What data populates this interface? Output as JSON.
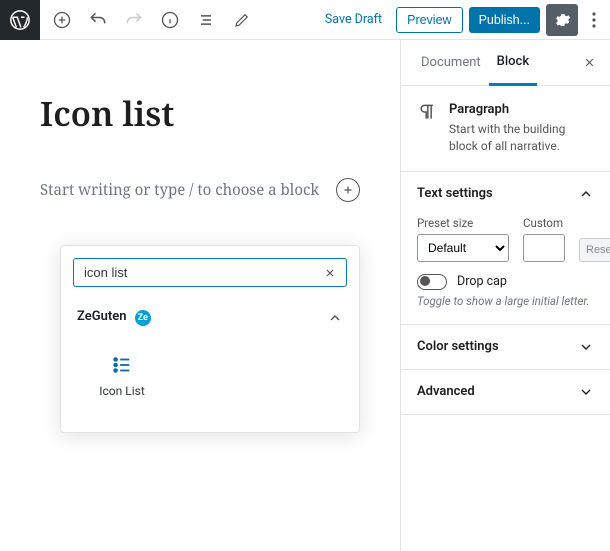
{
  "topbar": {
    "save_draft": "Save Draft",
    "preview": "Preview",
    "publish": "Publish..."
  },
  "editor": {
    "title": "Icon list",
    "placeholder": "Start writing or type / to choose a block"
  },
  "inserter": {
    "search_value": "icon list",
    "category": "ZeGuten",
    "badge": "Ze",
    "blocks": [
      {
        "label": "Icon List"
      }
    ]
  },
  "sidebar": {
    "tabs": {
      "document": "Document",
      "block": "Block"
    },
    "paragraph": {
      "title": "Paragraph",
      "desc": "Start with the building block of all narrative."
    },
    "text_settings": {
      "title": "Text settings",
      "preset_label": "Preset size",
      "preset_value": "Default",
      "custom_label": "Custom",
      "reset": "Reset",
      "dropcap_label": "Drop cap",
      "dropcap_help": "Toggle to show a large initial letter."
    },
    "color_settings": "Color settings",
    "advanced": "Advanced"
  }
}
